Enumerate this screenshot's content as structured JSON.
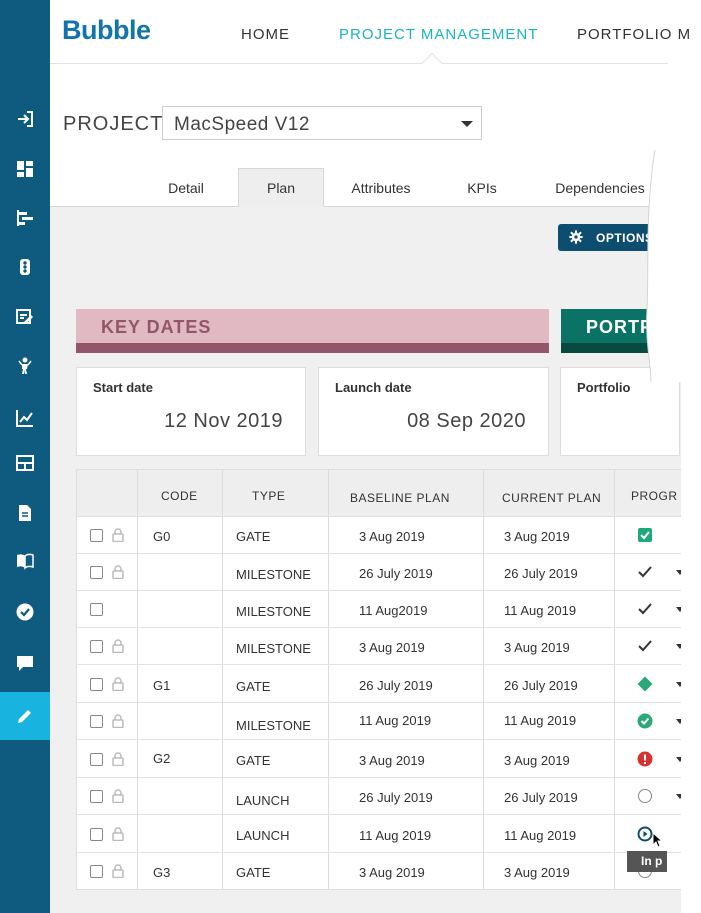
{
  "colors": {
    "sidebar": "#0f5a7f",
    "sidebar_active": "#19b3e0",
    "brand": "#1174ad",
    "nav_active": "#19b3c6",
    "key_dates_band": "#e0b9c3",
    "key_dates_accent": "#93556a",
    "portfolio_band": "#0a7366",
    "options_button": "#0d4d6f"
  },
  "sidebar": {
    "items": [
      {
        "icon": "sign-in-icon"
      },
      {
        "icon": "dashboard-icon"
      },
      {
        "icon": "gantt-icon"
      },
      {
        "icon": "traffic-light-icon"
      },
      {
        "icon": "edit-list-icon"
      },
      {
        "icon": "person-icon"
      },
      {
        "icon": "line-chart-icon"
      },
      {
        "icon": "layout-icon"
      },
      {
        "icon": "document-icon"
      },
      {
        "icon": "book-icon"
      },
      {
        "icon": "check-circle-icon"
      },
      {
        "icon": "chat-icon"
      },
      {
        "icon": "pencil-icon",
        "active": true
      }
    ]
  },
  "header": {
    "logo": "Bubble",
    "nav": [
      {
        "label": "HOME"
      },
      {
        "label": "PROJECT MANAGEMENT",
        "active": true
      },
      {
        "label": "PORTFOLIO M"
      }
    ]
  },
  "project": {
    "label": "PROJECT:",
    "selected": "MacSpeed V12"
  },
  "tabs": [
    {
      "label": "Detail"
    },
    {
      "label": "Plan",
      "active": true
    },
    {
      "label": "Attributes"
    },
    {
      "label": "KPIs"
    },
    {
      "label": "Dependencies"
    }
  ],
  "options_button": "OPTIONS",
  "sections": {
    "key_dates": "KEY DATES",
    "portfolio": "PORTFO"
  },
  "cards": [
    {
      "label": "Start date",
      "value": "12 Nov 2019"
    },
    {
      "label": "Launch date",
      "value": "08 Sep 2020"
    },
    {
      "label": "Portfolio",
      "value": ""
    }
  ],
  "table": {
    "headers": [
      "CODE",
      "TYPE",
      "BASELINE PLAN",
      "CURRENT PLAN",
      "PROGR"
    ],
    "rows": [
      {
        "code": "G0",
        "type": "GATE",
        "baseline": "3 Aug 2019",
        "current": "3 Aug 2019",
        "progress": "checkbox-checked-icon",
        "locked": true
      },
      {
        "code": "",
        "type": "MILESTONE",
        "baseline": "26 July 2019",
        "current": "26 July 2019",
        "progress": "check-icon",
        "locked": true
      },
      {
        "code": "",
        "type": "MILESTONE",
        "baseline": "11 Aug2019",
        "current": "11 Aug 2019",
        "progress": "check-icon",
        "locked": false
      },
      {
        "code": "",
        "type": "MILESTONE",
        "baseline": "3 Aug 2019",
        "current": "3 Aug 2019",
        "progress": "check-icon",
        "locked": true
      },
      {
        "code": "G1",
        "type": "GATE",
        "baseline": "26 July 2019",
        "current": "26 July 2019",
        "progress": "diamond-icon",
        "locked": true
      },
      {
        "code": "",
        "type": "MILESTONE",
        "baseline": "11 Aug 2019",
        "current": "11 Aug 2019",
        "progress": "check-circle-icon",
        "locked": true
      },
      {
        "code": "G2",
        "type": "GATE",
        "baseline": "3 Aug 2019",
        "current": "3 Aug 2019",
        "progress": "alert-icon",
        "locked": true
      },
      {
        "code": "",
        "type": "LAUNCH",
        "baseline": "26 July 2019",
        "current": "26 July 2019",
        "progress": "empty-circle-icon",
        "locked": true
      },
      {
        "code": "",
        "type": "LAUNCH",
        "baseline": "11 Aug 2019",
        "current": "11 Aug 2019",
        "progress": "play-circle-icon",
        "locked": true
      },
      {
        "code": "G3",
        "type": "GATE",
        "baseline": "3 Aug 2019",
        "current": "3 Aug 2019",
        "progress": "empty-circle-icon",
        "locked": true
      }
    ]
  },
  "tooltip": "In p"
}
